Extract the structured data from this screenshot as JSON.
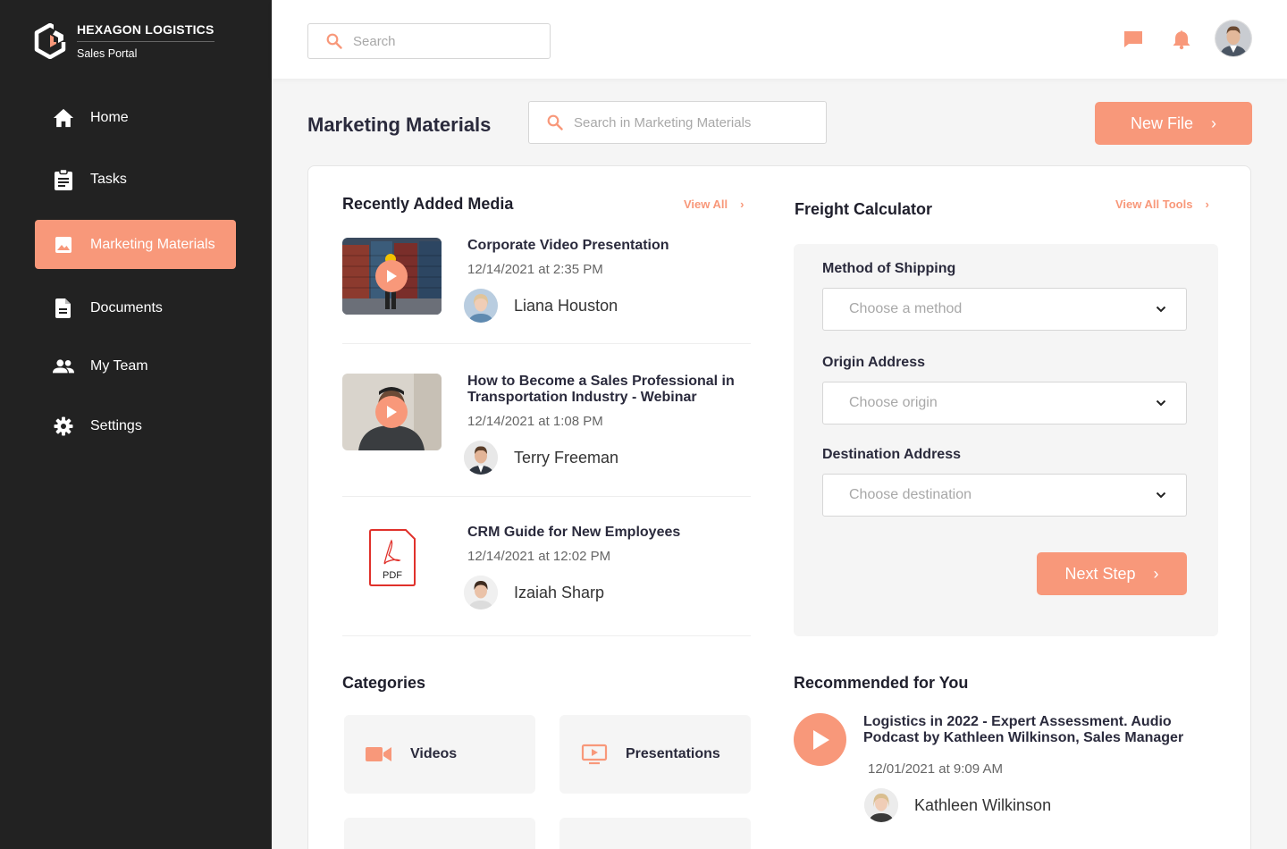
{
  "brand": {
    "title": "HEXAGON LOGISTICS",
    "subtitle": "Sales Portal"
  },
  "nav": {
    "items": [
      {
        "label": "Home",
        "icon": "home-icon"
      },
      {
        "label": "Tasks",
        "icon": "clipboard-icon"
      },
      {
        "label": "Marketing Materials",
        "icon": "image-icon",
        "active": true
      },
      {
        "label": "Documents",
        "icon": "document-icon"
      },
      {
        "label": "My Team",
        "icon": "team-icon"
      },
      {
        "label": "Settings",
        "icon": "gear-icon"
      }
    ]
  },
  "topbar": {
    "search_placeholder": "Search",
    "icons": [
      "chat-icon",
      "bell-icon",
      "user-avatar"
    ]
  },
  "page": {
    "title": "Marketing Materials",
    "search_placeholder": "Search in Marketing Materials",
    "new_file_label": "New File"
  },
  "recent": {
    "title": "Recently Added Media",
    "view_all": "View All",
    "items": [
      {
        "title": "Corporate Video Presentation",
        "date": "12/14/2021 at 2:35 PM",
        "author": "Liana Houston",
        "type": "video"
      },
      {
        "title": "How to Become a Sales Professional in Transportation Industry - Webinar",
        "date": "12/14/2021 at 1:08 PM",
        "author": "Terry Freeman",
        "type": "video"
      },
      {
        "title": "CRM Guide for New Employees",
        "date": "12/14/2021 at 12:02 PM",
        "author": "Izaiah Sharp",
        "type": "pdf",
        "file_label": "PDF"
      }
    ]
  },
  "freight": {
    "title": "Freight Calculator",
    "view_all": "View All Tools",
    "method_label": "Method of Shipping",
    "method_placeholder": "Choose a method",
    "origin_label": "Origin Address",
    "origin_placeholder": "Choose origin",
    "destination_label": "Destination Address",
    "destination_placeholder": "Choose destination",
    "next_label": "Next Step"
  },
  "categories": {
    "title": "Categories",
    "items": [
      {
        "label": "Videos",
        "icon": "video-camera-icon"
      },
      {
        "label": "Presentations",
        "icon": "presentation-icon"
      }
    ]
  },
  "recommended": {
    "title": "Recommended for You",
    "item": {
      "title": "Logistics in 2022 - Expert Assessment. Audio Podcast by Kathleen Wilkinson, Sales Manager",
      "date": "12/01/2021 at 9:09 AM",
      "author": "Kathleen Wilkinson"
    }
  },
  "colors": {
    "accent": "#f8987a",
    "sidebar": "#222222",
    "pdf_red": "#e0312b"
  }
}
